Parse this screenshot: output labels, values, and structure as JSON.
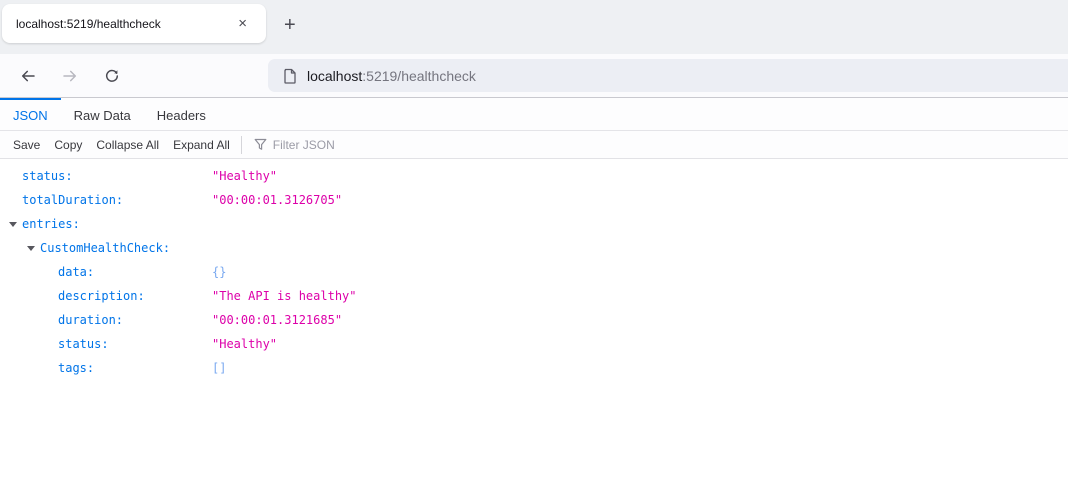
{
  "browser": {
    "tab_bar": {
      "tab_title": "localhost:5219/healthcheck",
      "close_icon": "×",
      "new_tab_icon": "+"
    },
    "address_bar": {
      "host": "localhost",
      "path": ":5219/healthcheck"
    },
    "icons": {
      "back": "back-arrow",
      "forward": "forward-arrow",
      "reload": "reload-circular-arrow",
      "page": "document-page",
      "filter": "funnel"
    }
  },
  "viewer": {
    "tabs": [
      {
        "label": "JSON",
        "active": true
      },
      {
        "label": "Raw Data",
        "active": false
      },
      {
        "label": "Headers",
        "active": false
      }
    ],
    "toolbar": {
      "save_label": "Save",
      "copy_label": "Copy",
      "collapse_label": "Collapse All",
      "expand_label": "Expand All",
      "filter_placeholder": "Filter JSON"
    }
  },
  "json_tree": {
    "rows": [
      {
        "indent": 1,
        "twisty": false,
        "key": "status:",
        "value": "\"Healthy\"",
        "type": "string"
      },
      {
        "indent": 1,
        "twisty": false,
        "key": "totalDuration:",
        "value": "\"00:00:01.3126705\"",
        "type": "string"
      },
      {
        "indent": 1,
        "twisty": true,
        "key": "entries:",
        "value": "",
        "type": "parent"
      },
      {
        "indent": 2,
        "twisty": true,
        "key": "CustomHealthCheck:",
        "value": "",
        "type": "parent"
      },
      {
        "indent": 3,
        "twisty": false,
        "key": "data:",
        "value": "{}",
        "type": "object"
      },
      {
        "indent": 3,
        "twisty": false,
        "key": "description:",
        "value": "\"The API is healthy\"",
        "type": "string"
      },
      {
        "indent": 3,
        "twisty": false,
        "key": "duration:",
        "value": "\"00:00:01.3121685\"",
        "type": "string"
      },
      {
        "indent": 3,
        "twisty": false,
        "key": "status:",
        "value": "\"Healthy\"",
        "type": "string"
      },
      {
        "indent": 3,
        "twisty": false,
        "key": "tags:",
        "value": "[]",
        "type": "object"
      }
    ]
  },
  "colors": {
    "accent_blue": "#0074e8",
    "key_blue": "#0074e8",
    "string_magenta": "#dd00a9",
    "empty_value_blue": "#7aa9f0",
    "tabbar_bg": "#eef0f3",
    "urlbar_bg": "#eceef4"
  }
}
